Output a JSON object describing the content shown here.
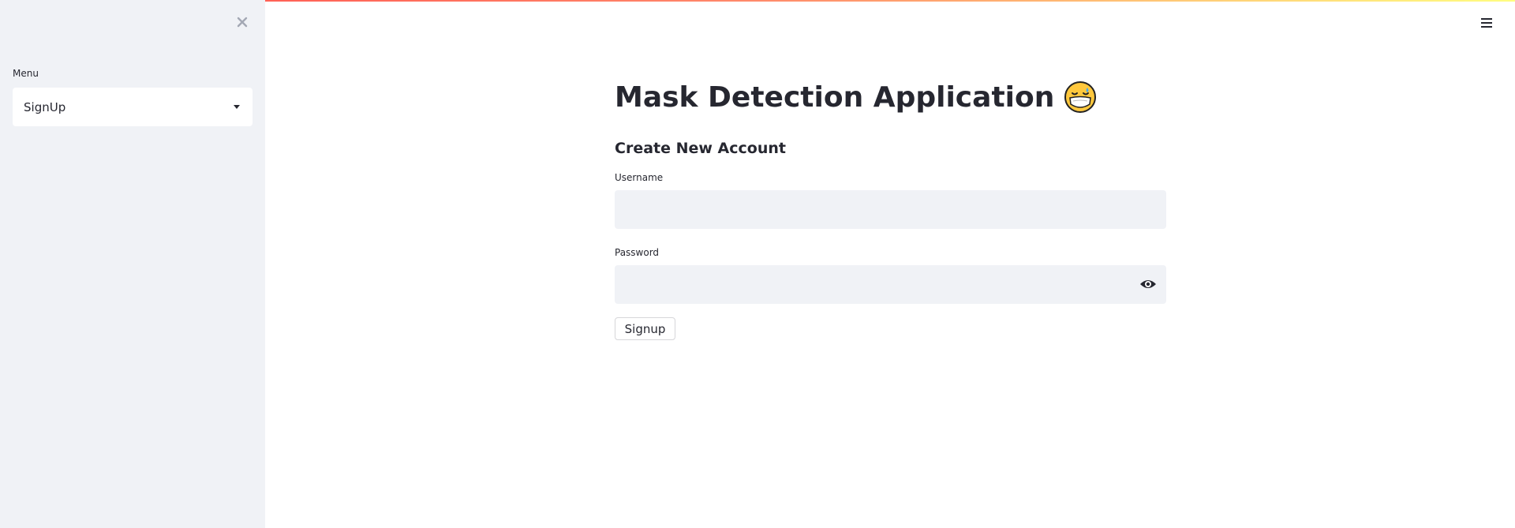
{
  "sidebar": {
    "menu_label": "Menu",
    "selected_option": "SignUp"
  },
  "main": {
    "title": "Mask Detection Application",
    "subtitle": "Create New Account",
    "username_label": "Username",
    "username_value": "",
    "password_label": "Password",
    "password_value": "",
    "signup_button": "Signup"
  },
  "icons": {
    "close": "close-icon",
    "caret": "chevron-down-icon",
    "menu": "hamburger-icon",
    "emoji": "mask-face-emoji-icon",
    "eye": "eye-icon"
  },
  "colors": {
    "sidebar_bg": "#f0f2f6",
    "text": "#262730",
    "input_bg": "#f0f2f6",
    "accent_gradient_start": "#ff4b4b",
    "accent_gradient_end": "#fffd80"
  }
}
